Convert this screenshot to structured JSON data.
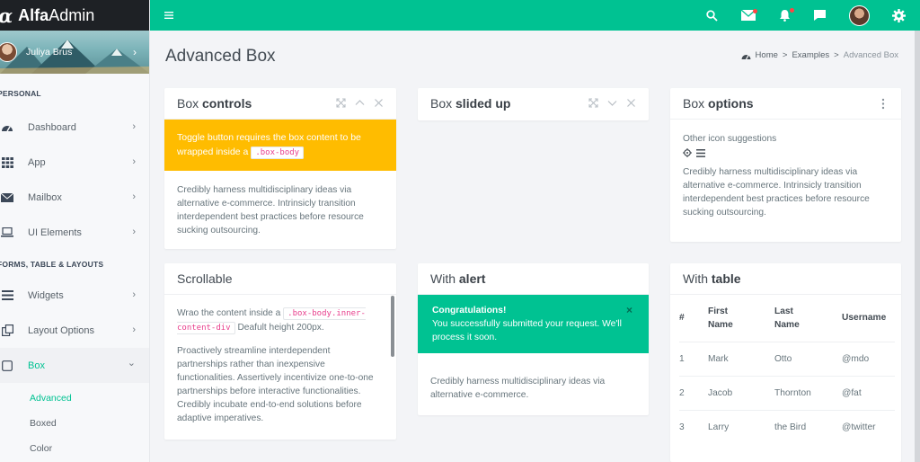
{
  "brand": {
    "mark": "α",
    "name_bold": "Alfa",
    "name_light": "Admin"
  },
  "user": {
    "name": "Juliya Brus",
    "chevron": "›"
  },
  "sidebar": {
    "sections": [
      {
        "label": "PERSONAL"
      },
      {
        "label": "FORMS, TABLE & LAYOUTS"
      }
    ],
    "items": [
      {
        "label": "Dashboard",
        "icon": "dashboard-icon",
        "chevron": "›"
      },
      {
        "label": "App",
        "icon": "grid-icon",
        "chevron": "›"
      },
      {
        "label": "Mailbox",
        "icon": "envelope-icon",
        "chevron": "›"
      },
      {
        "label": "UI Elements",
        "icon": "laptop-icon",
        "chevron": "›"
      },
      {
        "label": "Widgets",
        "icon": "bars-icon",
        "chevron": "›"
      },
      {
        "label": "Layout Options",
        "icon": "copy-icon",
        "chevron": "›"
      },
      {
        "label": "Box",
        "icon": "square-icon",
        "chevron": "⌄"
      }
    ],
    "subitems": [
      {
        "label": "Advanced"
      },
      {
        "label": "Boxed"
      },
      {
        "label": "Color"
      }
    ]
  },
  "topbar": {
    "icons": [
      "menu-icon",
      "search-icon",
      "mail-icon",
      "bell-icon",
      "chat-icon",
      "avatar",
      "gear-icon"
    ],
    "color": "#00c292"
  },
  "page": {
    "title": "Advanced Box",
    "breadcrumb": {
      "home": "Home",
      "sep": ">",
      "section": "Examples",
      "current": "Advanced Box"
    }
  },
  "boxes": {
    "controls": {
      "title_light": "Box ",
      "title_bold": "controls",
      "warning_text_1": "Toggle button requires the box content to be wrapped inside a ",
      "warning_code": ".box-body",
      "body": "Credibly harness multidisciplinary ideas via alternative e-commerce. Intrinsicly transition interdependent best practices before resource sucking outsourcing."
    },
    "slided": {
      "title_light": "Box ",
      "title_bold": "slided up"
    },
    "options": {
      "title_light": "Box ",
      "title_bold": "options",
      "suggestion": "Other icon suggestions",
      "body": "Credibly harness multidisciplinary ideas via alternative e-commerce. Intrinsicly transition interdependent best practices before resource sucking outsourcing."
    },
    "scrollable": {
      "title": "Scrollable",
      "text_1": "Wrao the content inside a ",
      "code": ".box-body.inner-content-div",
      "text_2": " Deafult height 200px.",
      "body": "Proactively streamline interdependent partnerships rather than inexpensive functionalities. Assertively incentivize one-to-one partnerships before interactive functionalities. Credibly incubate end-to-end solutions before adaptive imperatives."
    },
    "alert": {
      "title_light": "With ",
      "title_bold": "alert",
      "alert_title": "Congratulations!",
      "alert_text": "You successfully submitted your request. We'll process it soon.",
      "close": "×",
      "body": "Credibly harness multidisciplinary ideas via alternative e-commerce."
    },
    "table": {
      "title_light": "With ",
      "title_bold": "table",
      "headers": [
        "#",
        "First Name",
        "Last Name",
        "Username"
      ],
      "rows": [
        [
          "1",
          "Mark",
          "Otto",
          "@mdo"
        ],
        [
          "2",
          "Jacob",
          "Thornton",
          "@fat"
        ],
        [
          "3",
          "Larry",
          "the Bird",
          "@twitter"
        ]
      ]
    }
  }
}
